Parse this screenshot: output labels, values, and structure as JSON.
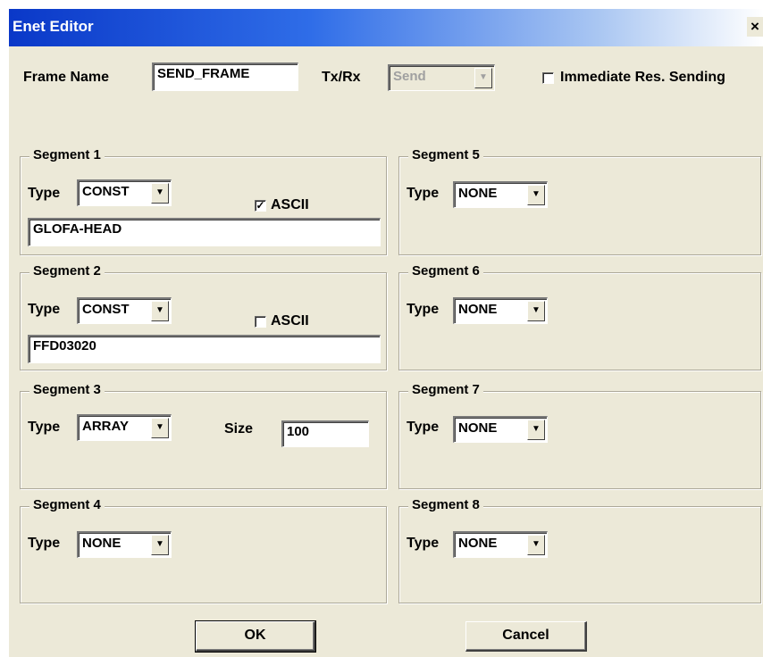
{
  "window": {
    "title": "Enet Editor",
    "close_glyph": "×"
  },
  "header": {
    "frame_name_label": "Frame Name",
    "frame_name_value": "SEND_FRAME",
    "txrx_label": "Tx/Rx",
    "txrx_value": "Send",
    "immediate_label": "Immediate Res. Sending",
    "immediate_checked": ""
  },
  "segments": [
    {
      "title": "Segment 1",
      "type_label": "Type",
      "type_value": "CONST",
      "ascii_label": "ASCII",
      "ascii_check": "✓",
      "data_value": "GLOFA-HEAD"
    },
    {
      "title": "Segment 2",
      "type_label": "Type",
      "type_value": "CONST",
      "ascii_label": "ASCII",
      "ascii_check": "",
      "data_value": "FFD03020"
    },
    {
      "title": "Segment 3",
      "type_label": "Type",
      "type_value": "ARRAY",
      "size_label": "Size",
      "size_value": "100"
    },
    {
      "title": "Segment 4",
      "type_label": "Type",
      "type_value": "NONE"
    },
    {
      "title": "Segment 5",
      "type_label": "Type",
      "type_value": "NONE"
    },
    {
      "title": "Segment 6",
      "type_label": "Type",
      "type_value": "NONE"
    },
    {
      "title": "Segment 7",
      "type_label": "Type",
      "type_value": "NONE"
    },
    {
      "title": "Segment 8",
      "type_label": "Type",
      "type_value": "NONE"
    }
  ],
  "buttons": {
    "ok": "OK",
    "cancel": "Cancel"
  },
  "icons": {
    "dropdown": "chevron-down-icon",
    "close": "close-icon",
    "check": "checkmark-icon"
  },
  "colors": {
    "titlebar_start": "#0a38c8",
    "dialog_bg": "#ece9d8"
  }
}
